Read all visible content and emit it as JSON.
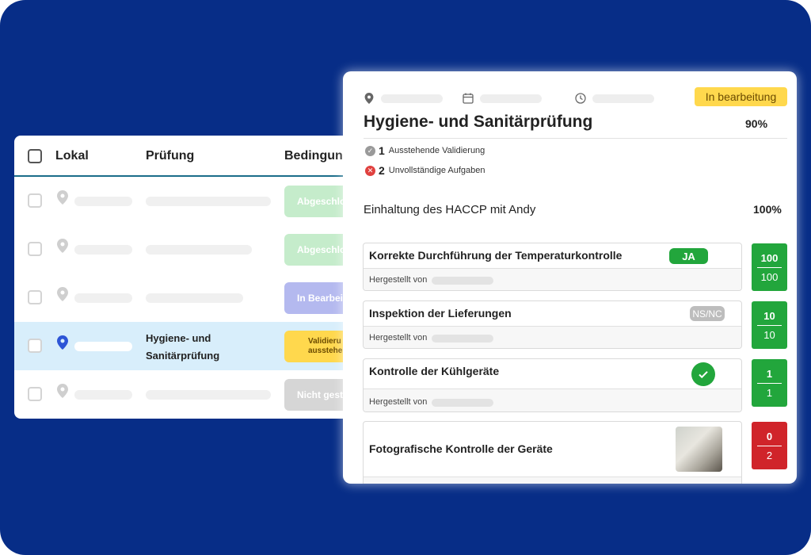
{
  "colors": {
    "background": "#072d87",
    "green": "#22a63c",
    "red": "#d0242a",
    "accent": "#1b6d8a"
  },
  "table": {
    "headers": {
      "lokal": "Lokal",
      "pruefung": "Prüfung",
      "bedingung": "Bedingun"
    },
    "rows": [
      {
        "status": "Abgeschlo",
        "status_color": "#c5eccb",
        "status_text_color": "#ffffff"
      },
      {
        "status": "Abgeschlo",
        "status_color": "#c5eccb",
        "status_text_color": "#ffffff"
      },
      {
        "status": "In Bearbei",
        "status_color": "#b4b9ef",
        "status_text_color": "#ffffff"
      },
      {
        "title": "Hygiene- und Sanitärprüfung",
        "status_line1": "Validieru",
        "status_line2": "ausstehe",
        "status_color": "#ffd84d",
        "status_text_color": "#6b4b00"
      },
      {
        "status": "Nicht gest",
        "status_color": "#d6d6d6",
        "status_text_color": "#ffffff"
      }
    ]
  },
  "detail": {
    "badge": "In bearbeitung",
    "title": "Hygiene- und Sanitärprüfung",
    "percent": "90%",
    "pending_count": "1",
    "pending_label": "Ausstehende Validierung",
    "incomplete_count": "2",
    "incomplete_label": "Unvollständige Aufgaben",
    "section_title": "Einhaltung des HACCP mit Andy",
    "section_percent": "100%",
    "made_by_label": "Hergestellt von",
    "tasks": [
      {
        "title": "Korrekte Durchführung der Temperaturkontrolle",
        "answer": "JA",
        "score_num": "100",
        "score_den": "100"
      },
      {
        "title": "Inspektion der Lieferungen",
        "answer": "NS/NC",
        "score_num": "10",
        "score_den": "10"
      },
      {
        "title": "Kontrolle der Kühlgeräte",
        "answer_icon": "check-icon",
        "score_num": "1",
        "score_den": "1"
      },
      {
        "title": "Fotografische Kontrolle der Geräte",
        "answer_icon": "photo-thumbnail",
        "score_num": "0",
        "score_den": "2"
      }
    ]
  }
}
